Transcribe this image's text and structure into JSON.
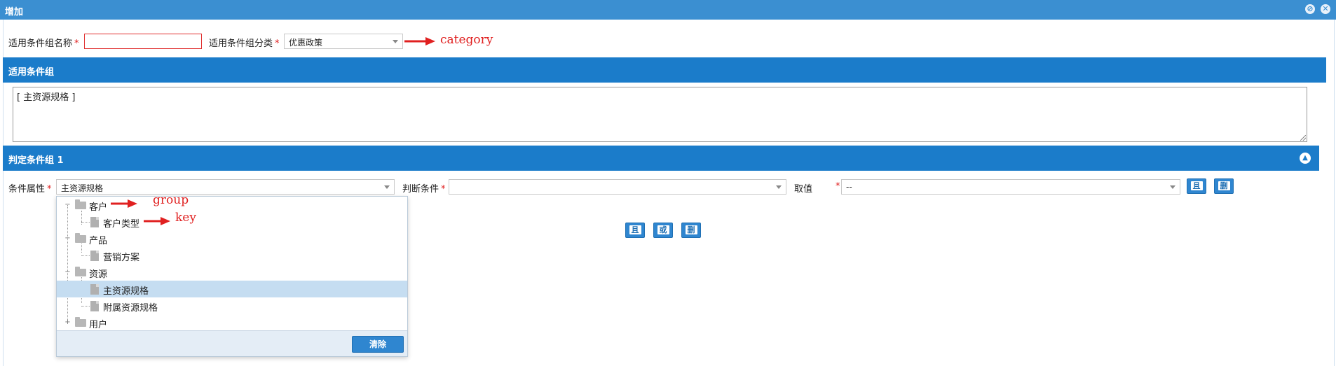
{
  "window": {
    "title": "增加",
    "minimize_icon": "minimize-icon",
    "close_icon": "close-icon"
  },
  "form": {
    "group_name_label": "适用条件组名称",
    "group_name_value": "",
    "category_label": "适用条件组分类",
    "category_value": "优惠政策",
    "required_mark": "*"
  },
  "applicable_group": {
    "title": "适用条件组",
    "text": "[ 主资源规格 ]"
  },
  "judge_group": {
    "title": "判定条件组 1",
    "attr_label": "条件属性",
    "attr_value": "主资源规格",
    "cond_label": "判断条件",
    "cond_value": "",
    "value_label": "取值",
    "value_value": "--",
    "and_btn": "且",
    "del_btn": "删",
    "or_btn": "或"
  },
  "tree": {
    "nodes": [
      {
        "label": "客户",
        "type": "folder",
        "expanded": true
      },
      {
        "label": "客户类型",
        "type": "leaf"
      },
      {
        "label": "产品",
        "type": "folder",
        "expanded": true
      },
      {
        "label": "营销方案",
        "type": "leaf"
      },
      {
        "label": "资源",
        "type": "folder",
        "expanded": true
      },
      {
        "label": "主资源规格",
        "type": "leaf",
        "selected": true
      },
      {
        "label": "附属资源规格",
        "type": "leaf"
      },
      {
        "label": "用户",
        "type": "folder",
        "expanded": false
      }
    ],
    "clear_btn": "清除"
  },
  "annotations": {
    "category": "category",
    "group": "group",
    "key": "key",
    "color": "#e02020"
  },
  "colors": {
    "title_bar": "#3b8fd1",
    "section_bar": "#1b7cca",
    "button": "#2f86d0",
    "selected_row": "#c5ddf1"
  }
}
